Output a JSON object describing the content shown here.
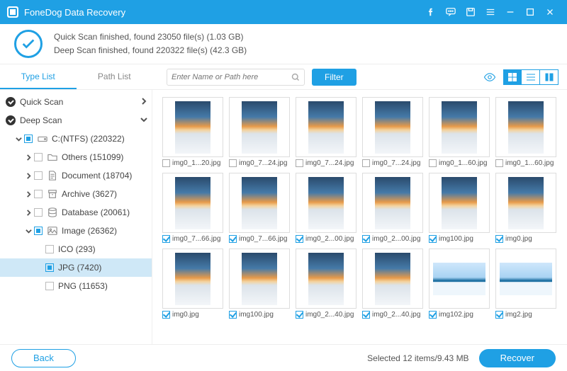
{
  "app": {
    "title": "FoneDog Data Recovery"
  },
  "status": {
    "line1": "Quick Scan finished, found 23050 file(s) (1.03 GB)",
    "line2": "Deep Scan finished, found 220322 file(s) (42.3 GB)"
  },
  "tabs": {
    "type_list": "Type List",
    "path_list": "Path List"
  },
  "search": {
    "placeholder": "Enter Name or Path here"
  },
  "filter": {
    "label": "Filter"
  },
  "sidebar": {
    "quick_scan": "Quick Scan",
    "deep_scan": "Deep Scan",
    "drive": "C:(NTFS) (220322)",
    "others": "Others (151099)",
    "document": "Document (18704)",
    "archive": "Archive (3627)",
    "database": "Database (20061)",
    "image": "Image (26362)",
    "ico": "ICO (293)",
    "jpg": "JPG (7420)",
    "png": "PNG (11653)"
  },
  "grid": {
    "items": [
      {
        "label": "img0_1...20.jpg",
        "checked": false,
        "wide": false
      },
      {
        "label": "img0_7...24.jpg",
        "checked": false,
        "wide": false
      },
      {
        "label": "img0_7...24.jpg",
        "checked": false,
        "wide": false
      },
      {
        "label": "img0_7...24.jpg",
        "checked": false,
        "wide": false
      },
      {
        "label": "img0_1...60.jpg",
        "checked": false,
        "wide": false
      },
      {
        "label": "img0_1...60.jpg",
        "checked": false,
        "wide": false
      },
      {
        "label": "img0_7...66.jpg",
        "checked": true,
        "wide": false
      },
      {
        "label": "img0_7...66.jpg",
        "checked": true,
        "wide": false
      },
      {
        "label": "img0_2...00.jpg",
        "checked": true,
        "wide": false
      },
      {
        "label": "img0_2...00.jpg",
        "checked": true,
        "wide": false
      },
      {
        "label": "img100.jpg",
        "checked": true,
        "wide": false
      },
      {
        "label": "img0.jpg",
        "checked": true,
        "wide": false
      },
      {
        "label": "img0.jpg",
        "checked": true,
        "wide": false
      },
      {
        "label": "img100.jpg",
        "checked": true,
        "wide": false
      },
      {
        "label": "img0_2...40.jpg",
        "checked": true,
        "wide": false
      },
      {
        "label": "img0_2...40.jpg",
        "checked": true,
        "wide": false
      },
      {
        "label": "img102.jpg",
        "checked": true,
        "wide": true
      },
      {
        "label": "img2.jpg",
        "checked": true,
        "wide": true
      }
    ]
  },
  "footer": {
    "back": "Back",
    "selected": "Selected 12 items/9.43 MB",
    "recover": "Recover"
  }
}
